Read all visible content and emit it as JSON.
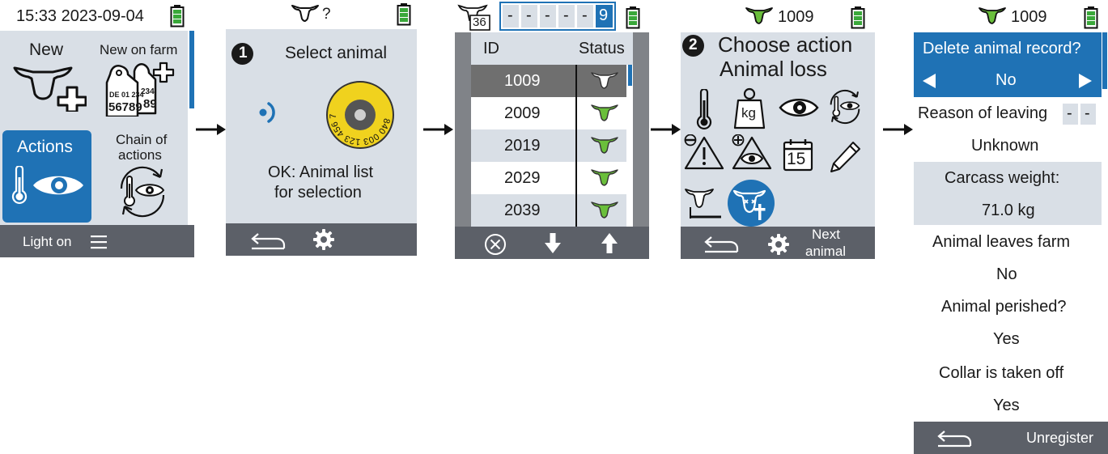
{
  "screen1": {
    "status_time": "15:33 2023-09-04",
    "tiles": {
      "new": "New",
      "new_on_farm": "New on farm",
      "tag_line1": "DE 01 234",
      "tag_line2": "56789",
      "tag_back_line1": "234",
      "tag_back_line2": "89",
      "actions": "Actions",
      "chain_line1": "Chain of",
      "chain_line2": "actions"
    },
    "footer": {
      "light": "Light on"
    }
  },
  "screen2": {
    "status_id": "?",
    "step": "1",
    "title": "Select animal",
    "tag_number": "840 003 123 456 789",
    "hint_line1": "OK: Animal list",
    "hint_line2": "for selection"
  },
  "screen3": {
    "herd_count": "36",
    "digits": [
      "-",
      "-",
      "-",
      "-",
      "-",
      "9"
    ],
    "columns": {
      "id": "ID",
      "status": "Status"
    },
    "rows": [
      {
        "id": "1009",
        "selected": true
      },
      {
        "id": "2009",
        "selected": false
      },
      {
        "id": "2019",
        "selected": false
      },
      {
        "id": "2029",
        "selected": false
      },
      {
        "id": "2039",
        "selected": false
      }
    ]
  },
  "screen4": {
    "status_id": "1009",
    "step": "2",
    "title_line1": "Choose action",
    "title_line2": "Animal loss",
    "kg_label": "kg",
    "calendar_day": "15",
    "footer": {
      "next_line1": "Next",
      "next_line2": "animal"
    }
  },
  "screen5": {
    "status_id": "1009",
    "question": "Delete animal record?",
    "answer": "No",
    "reason_label": "Reason of leaving",
    "reason_value": "Unknown",
    "weight_label": "Carcass weight:",
    "weight_value": "71.0 kg",
    "leaves_label": "Animal leaves farm",
    "leaves_value": "No",
    "perished_label": "Animal perished?",
    "perished_value": "Yes",
    "collar_label": "Collar is taken off",
    "collar_value": "Yes",
    "footer": {
      "unregister": "Unregister"
    }
  },
  "colors": {
    "panel": "#d9dfe6",
    "footer": "#5c6068",
    "accent_blue": "#1f72b5",
    "cow_green": "#6abf3b",
    "tag_yellow": "#f0d21e",
    "selected_row": "#6f6f6f"
  }
}
